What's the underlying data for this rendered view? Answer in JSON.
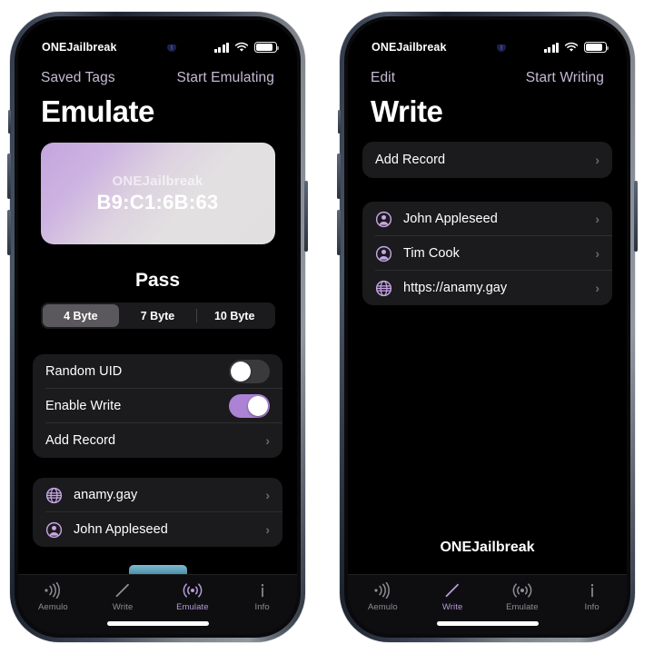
{
  "accent": "#b79add",
  "toggle_on_color": "#ab82d4",
  "link_color": "#c6bad6",
  "card_gradient_from": "#c4a5de",
  "card_gradient_to": "#e1dfe0",
  "peek_bar_color": "#6fb0c9",
  "left_phone": {
    "status_bar": {
      "title": "ONEJailbreak",
      "lock_icon": "lock-indicator-icon",
      "signal_icon": "cellular-signal-icon",
      "wifi_icon": "wifi-icon",
      "battery_icon": "battery-icon"
    },
    "nav": {
      "left_label": "Saved Tags",
      "right_label": "Start Emulating"
    },
    "title": "Emulate",
    "tag_card": {
      "brand": "ONEJailbreak",
      "uid": "B9:C1:6B:63"
    },
    "pass_heading": "Pass",
    "segmented": {
      "options": [
        "4 Byte",
        "7 Byte",
        "10 Byte"
      ],
      "selected_index": 0
    },
    "settings_group": [
      {
        "label": "Random UID",
        "type": "toggle",
        "value": "off",
        "icon": ""
      },
      {
        "label": "Enable Write",
        "type": "toggle",
        "value": "on",
        "icon": ""
      },
      {
        "label": "Add Record",
        "type": "disclosure",
        "value": "",
        "icon": ""
      }
    ],
    "records_group": [
      {
        "label": "anamy.gay",
        "icon": "globe-icon",
        "type": "disclosure"
      },
      {
        "label": "John Appleseed",
        "icon": "person-icon",
        "type": "disclosure"
      }
    ],
    "tabs": [
      {
        "label": "Aemulo",
        "icon": "nfc-wave-icon",
        "active": false
      },
      {
        "label": "Write",
        "icon": "pencil-icon",
        "active": false
      },
      {
        "label": "Emulate",
        "icon": "broadcast-icon",
        "active": true
      },
      {
        "label": "Info",
        "icon": "info-icon",
        "active": false
      }
    ]
  },
  "right_phone": {
    "status_bar": {
      "title": "ONEJailbreak",
      "lock_icon": "lock-indicator-icon",
      "signal_icon": "cellular-signal-icon",
      "wifi_icon": "wifi-icon",
      "battery_icon": "battery-icon"
    },
    "nav": {
      "left_label": "Edit",
      "right_label": "Start Writing"
    },
    "title": "Write",
    "add_record": {
      "label": "Add Record"
    },
    "records_group": [
      {
        "label": "John Appleseed",
        "icon": "person-icon",
        "type": "disclosure"
      },
      {
        "label": "Tim Cook",
        "icon": "person-icon",
        "type": "disclosure"
      },
      {
        "label": "https://anamy.gay",
        "icon": "globe-icon",
        "type": "disclosure"
      }
    ],
    "watermark": "ONEJailbreak",
    "tabs": [
      {
        "label": "Aemulo",
        "icon": "nfc-wave-icon",
        "active": false
      },
      {
        "label": "Write",
        "icon": "pencil-icon",
        "active": true
      },
      {
        "label": "Emulate",
        "icon": "broadcast-icon",
        "active": false
      },
      {
        "label": "Info",
        "icon": "info-icon",
        "active": false
      }
    ]
  },
  "chevron_glyph": "›"
}
